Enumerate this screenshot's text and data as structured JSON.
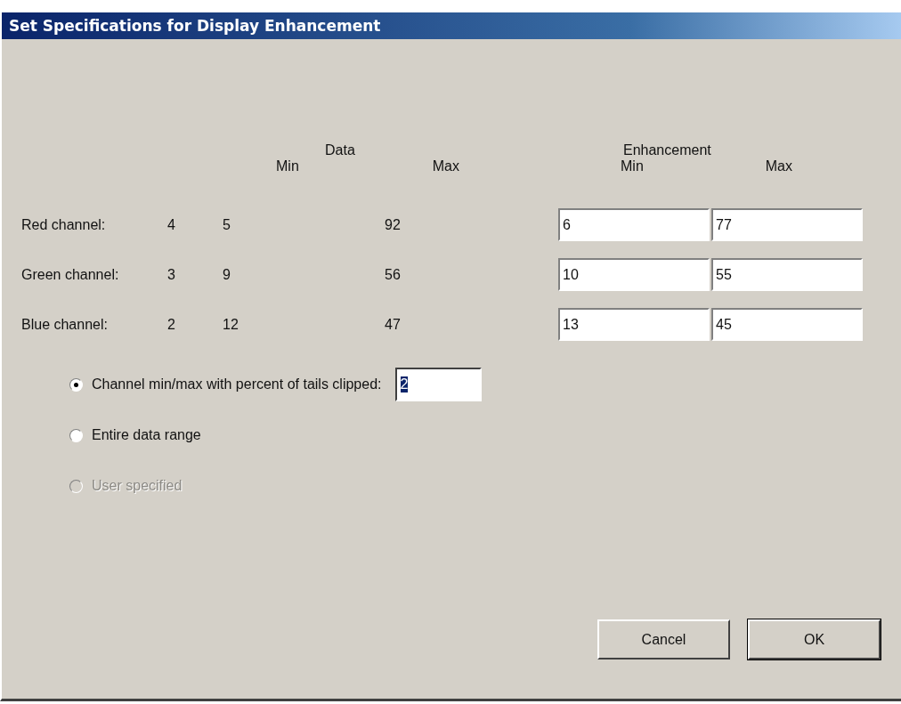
{
  "window": {
    "title": "Set Specifications for Display Enhancement"
  },
  "headers": {
    "data": "Data",
    "data_min": "Min",
    "data_max": "Max",
    "enhancement": "Enhancement",
    "enh_min": "Min",
    "enh_max": "Max"
  },
  "channels": [
    {
      "label": "Red channel:",
      "column_2": "4",
      "data_min": "5",
      "data_max": "92",
      "enh_min": "6",
      "enh_max": "77"
    },
    {
      "label": "Green channel:",
      "column_2": "3",
      "data_min": "9",
      "data_max": "56",
      "enh_min": "10",
      "enh_max": "55"
    },
    {
      "label": "Blue channel:",
      "column_2": "2",
      "data_min": "12",
      "data_max": "47",
      "enh_min": "13",
      "enh_max": "45"
    }
  ],
  "options": [
    {
      "label": "Channel min/max with percent of tails clipped:",
      "selected": true,
      "disabled": false,
      "field": {
        "value": "2",
        "highlighted": true
      }
    },
    {
      "label": "Entire data range",
      "selected": false,
      "disabled": false
    },
    {
      "label": "User specified",
      "selected": false,
      "disabled": true
    }
  ],
  "buttons": [
    {
      "label": "Cancel",
      "default": false
    },
    {
      "label": "OK",
      "default": true
    }
  ]
}
